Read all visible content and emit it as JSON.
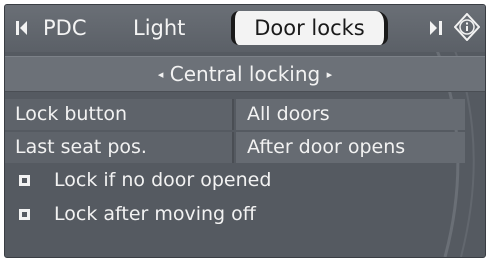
{
  "tabs": {
    "left_arrow": "◀",
    "items": [
      "PDC",
      "Light",
      "Door locks"
    ],
    "active": "Door locks",
    "right_arrow": "▶",
    "info_icon": "info-icon"
  },
  "submenu": {
    "left_arrow": "◂",
    "title": "Central locking",
    "right_arrow": "▸"
  },
  "settings": [
    {
      "label": "Lock button",
      "value": "All doors"
    },
    {
      "label": "Last seat pos.",
      "value": "After door opens"
    }
  ],
  "options": [
    {
      "label": "Lock if no door opened",
      "checked": false
    },
    {
      "label": "Lock after moving off",
      "checked": false
    }
  ],
  "colors": {
    "screen_bg": "#555a61",
    "active_tab_bg": "#f3f3f3",
    "text": "#f2f2f2"
  }
}
